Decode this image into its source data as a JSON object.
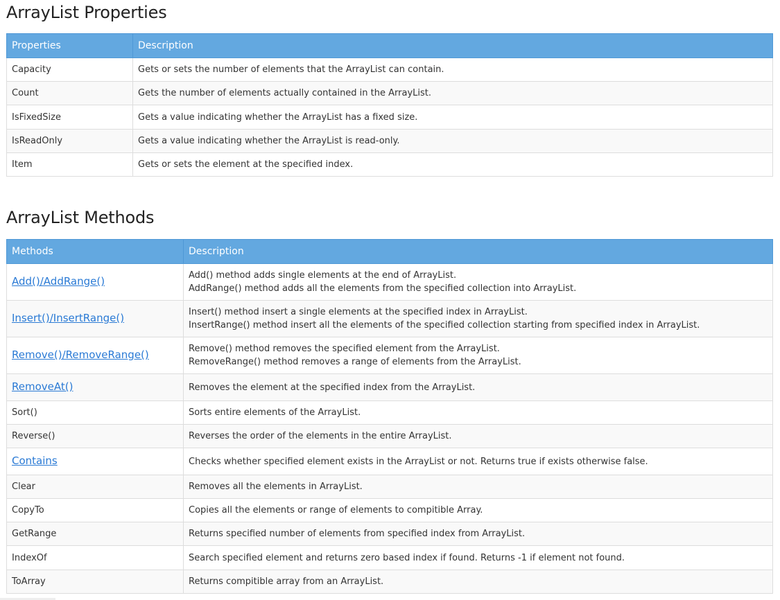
{
  "properties_section": {
    "title": "ArrayList Properties",
    "headers": [
      "Properties",
      "Description"
    ],
    "rows": [
      {
        "name": "Capacity",
        "description": "Gets or sets the number of elements that the ArrayList can contain."
      },
      {
        "name": "Count",
        "description": "Gets the number of elements actually contained in the ArrayList."
      },
      {
        "name": "IsFixedSize",
        "description": "Gets a value indicating whether the ArrayList has a fixed size."
      },
      {
        "name": "IsReadOnly",
        "description": "Gets a value indicating whether the ArrayList is read-only."
      },
      {
        "name": "Item",
        "description": "Gets or sets the element at the specified index."
      }
    ]
  },
  "methods_section": {
    "title": "ArrayList Methods",
    "headers": [
      "Methods",
      "Description"
    ],
    "rows": [
      {
        "name": "Add()/AddRange()",
        "link": true,
        "description": [
          "Add() method adds single elements at the end of ArrayList.",
          "AddRange() method adds all the elements from the specified collection into ArrayList."
        ]
      },
      {
        "name": "Insert()/InsertRange()",
        "link": true,
        "description": [
          "Insert() method insert a single elements at the specified index in ArrayList.",
          "InsertRange() method insert all the elements of the specified collection starting from specified index in ArrayList."
        ]
      },
      {
        "name": "Remove()/RemoveRange()",
        "link": true,
        "description": [
          "Remove() method removes the specified element from the ArrayList.",
          "RemoveRange() method removes a range of elements from the ArrayList."
        ]
      },
      {
        "name": "RemoveAt()",
        "link": true,
        "description": [
          "Removes the element at the specified index from the ArrayList."
        ]
      },
      {
        "name": "Sort()",
        "link": false,
        "description": [
          "Sorts entire elements of the ArrayList."
        ]
      },
      {
        "name": "Reverse()",
        "link": false,
        "description": [
          "Reverses the order of the elements in the entire ArrayList."
        ]
      },
      {
        "name": "Contains",
        "link": true,
        "description": [
          "Checks whether specified element exists in the ArrayList or not. Returns true if exists otherwise false."
        ]
      },
      {
        "name": "Clear",
        "link": false,
        "description": [
          "Removes all the elements in ArrayList."
        ]
      },
      {
        "name": "CopyTo",
        "link": false,
        "description": [
          "Copies all the elements or range of elements to compitible Array."
        ]
      },
      {
        "name": "GetRange",
        "link": false,
        "description": [
          "Returns specified number of elements from specified index from ArrayList."
        ]
      },
      {
        "name": "IndexOf",
        "link": false,
        "description": [
          "Search specified element and returns zero based index if found. Returns -1 if element not found."
        ]
      },
      {
        "name": "ToArray",
        "link": false,
        "description": [
          "Returns compitible array from an ArrayList."
        ]
      }
    ]
  }
}
